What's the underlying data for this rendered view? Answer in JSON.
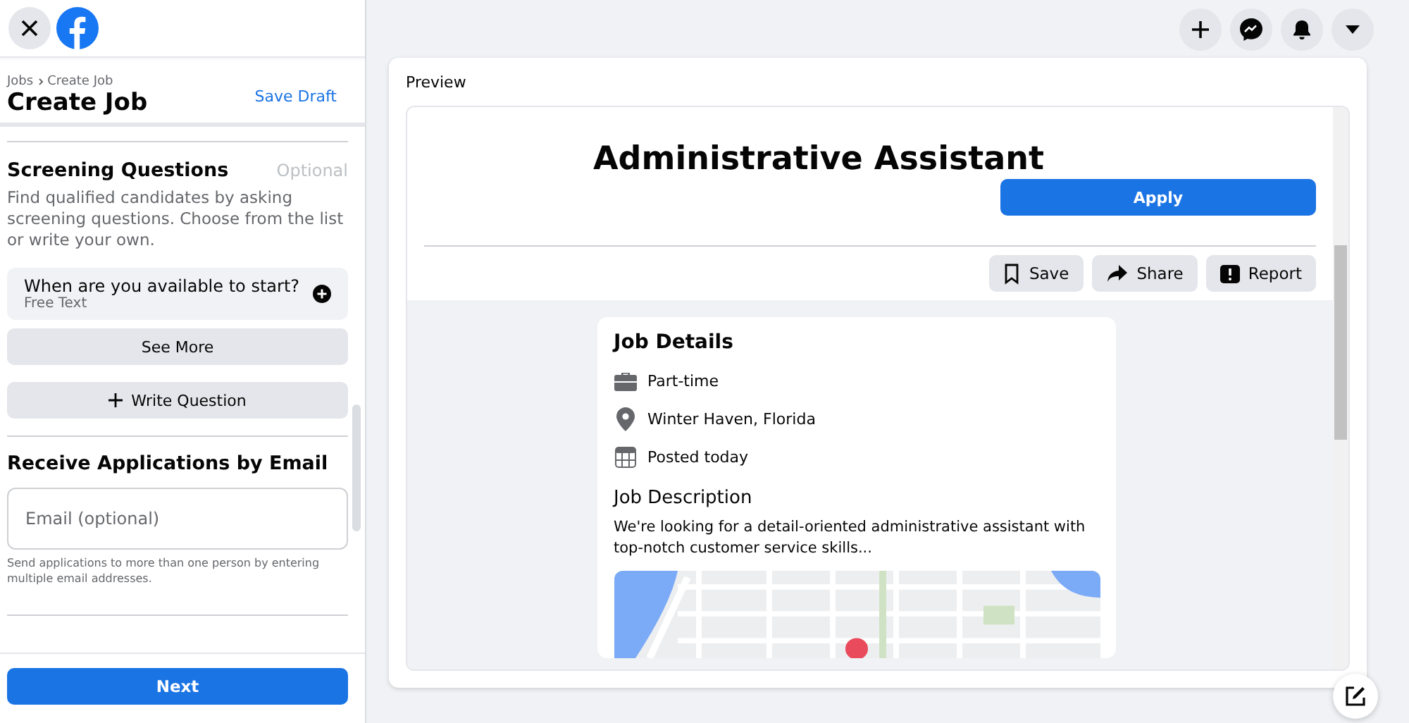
{
  "sidebar": {
    "breadcrumb": [
      "Jobs",
      "Create Job"
    ],
    "title": "Create Job",
    "save_draft": "Save Draft",
    "screening": {
      "title": "Screening Questions",
      "optional": "Optional",
      "description": "Find qualified candidates by asking screening questions. Choose from the list or write your own.",
      "questions": [
        {
          "text": "When are you available to start?",
          "type": "Free Text"
        }
      ],
      "see_more": "See More",
      "write_question": "Write Question"
    },
    "email_section": {
      "title": "Receive Applications by Email",
      "placeholder": "Email (optional)",
      "help": "Send applications to more than one person by entering multiple email addresses."
    },
    "next": "Next"
  },
  "preview": {
    "label": "Preview",
    "job_title": "Administrative Assistant",
    "apply": "Apply",
    "actions": [
      {
        "kind": "save",
        "label": "Save"
      },
      {
        "kind": "share",
        "label": "Share"
      },
      {
        "kind": "report",
        "label": "Report"
      }
    ],
    "details": {
      "title": "Job Details",
      "items": [
        {
          "kind": "briefcase",
          "text": "Part-time"
        },
        {
          "kind": "pin",
          "text": "Winter Haven, Florida"
        },
        {
          "kind": "calendar",
          "text": "Posted today"
        }
      ],
      "description_title": "Job Description",
      "description": "We're looking for a detail-oriented administrative assistant with top-notch customer service skills..."
    }
  }
}
